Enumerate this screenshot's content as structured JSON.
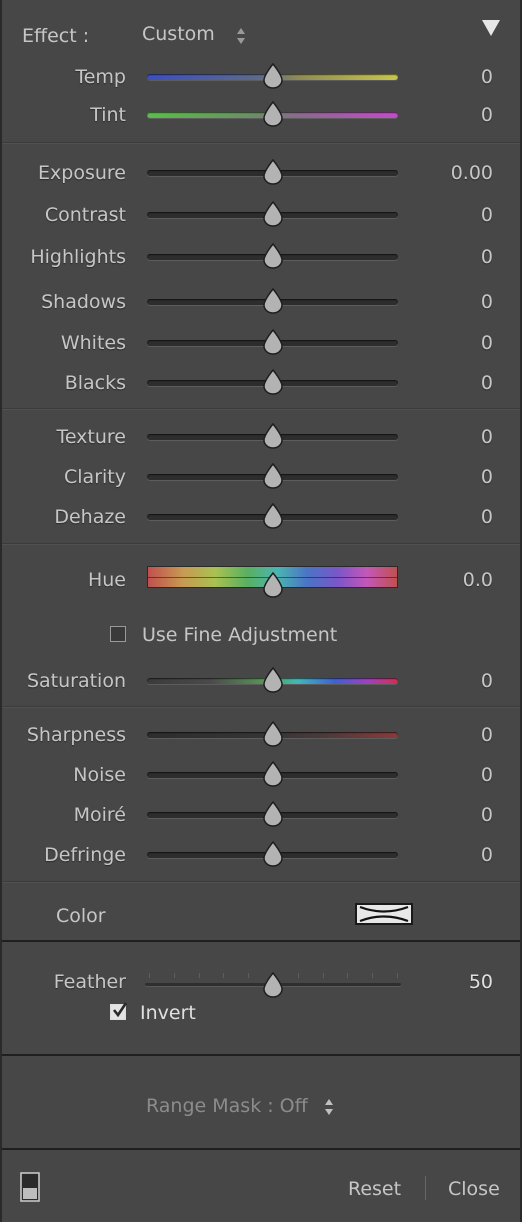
{
  "effect": {
    "label": "Effect :",
    "value": "Custom"
  },
  "sliders": [
    {
      "key": "temp",
      "label": "Temp",
      "value": "0",
      "track": "temp"
    },
    {
      "key": "tint",
      "label": "Tint",
      "value": "0",
      "track": "tint"
    },
    {
      "key": "exposure",
      "label": "Exposure",
      "value": "0.00",
      "track": "gray"
    },
    {
      "key": "contrast",
      "label": "Contrast",
      "value": "0",
      "track": "gray"
    },
    {
      "key": "highlights",
      "label": "Highlights",
      "value": "0",
      "track": "gray"
    },
    {
      "key": "shadows",
      "label": "Shadows",
      "value": "0",
      "track": "gray"
    },
    {
      "key": "whites",
      "label": "Whites",
      "value": "0",
      "track": "gray"
    },
    {
      "key": "blacks",
      "label": "Blacks",
      "value": "0",
      "track": "gray"
    },
    {
      "key": "texture",
      "label": "Texture",
      "value": "0",
      "track": "gray"
    },
    {
      "key": "clarity",
      "label": "Clarity",
      "value": "0",
      "track": "gray"
    },
    {
      "key": "dehaze",
      "label": "Dehaze",
      "value": "0",
      "track": "gray"
    },
    {
      "key": "saturation",
      "label": "Saturation",
      "value": "0",
      "track": "saturation"
    },
    {
      "key": "sharpness",
      "label": "Sharpness",
      "value": "0",
      "track": "sharpness"
    },
    {
      "key": "noise",
      "label": "Noise",
      "value": "0",
      "track": "gray"
    },
    {
      "key": "moire",
      "label": "Moiré",
      "value": "0",
      "track": "gray"
    },
    {
      "key": "defringe",
      "label": "Defringe",
      "value": "0",
      "track": "gray"
    }
  ],
  "hue": {
    "label": "Hue",
    "value": "0.0"
  },
  "fine_adjustment": {
    "label": "Use Fine Adjustment",
    "checked": false
  },
  "color": {
    "label": "Color"
  },
  "feather": {
    "label": "Feather",
    "value": "50",
    "level": 0.5
  },
  "invert": {
    "label": "Invert",
    "checked": true
  },
  "range_mask": {
    "label": "Range Mask : Off"
  },
  "footer": {
    "reset": "Reset",
    "close": "Close"
  },
  "icons": {
    "collapse": "triangle-down-icon",
    "updown": "updown-arrows-icon",
    "mask_overlay": "mask-overlay-toggle-icon",
    "no_color": "no-color-swatch-icon"
  },
  "colors": {
    "panel_bg": "#474747",
    "text": "#c6c6c6",
    "track": "#2d2d2d",
    "thumb": "#b0b0b0"
  }
}
